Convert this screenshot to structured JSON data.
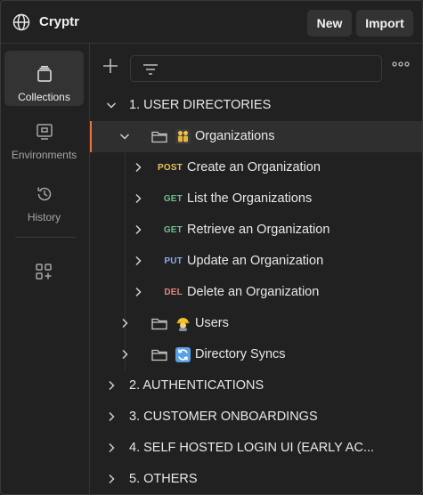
{
  "header": {
    "workspace_name": "Cryptr",
    "workspace_icon": "globe-icon",
    "new_label": "New",
    "import_label": "Import"
  },
  "sidebar": {
    "items": [
      {
        "label": "Collections",
        "icon": "collections-icon",
        "active": true
      },
      {
        "label": "Environments",
        "icon": "environments-icon",
        "active": false
      },
      {
        "label": "History",
        "icon": "history-icon",
        "active": false
      }
    ],
    "configure_icon": "configure-workbench-icon"
  },
  "toolbar": {
    "add_icon": "plus-icon",
    "filter_icon": "filter-icon",
    "more_icon": "more-options-icon"
  },
  "tree": {
    "collection": {
      "label": "1. USER DIRECTORIES",
      "expanded": true
    },
    "organizations": {
      "label": "Organizations",
      "emoji": "👬"
    },
    "requests": [
      {
        "method": "POST",
        "label": "Create an Organization"
      },
      {
        "method": "GET",
        "label": "List the Organizations"
      },
      {
        "method": "GET",
        "label": "Retrieve an Organization"
      },
      {
        "method": "PUT",
        "label": "Update an Organization"
      },
      {
        "method": "DEL",
        "label": "Delete an Organization"
      }
    ],
    "folders": [
      {
        "label": "Users",
        "emoji": "👷"
      },
      {
        "label": "Directory Syncs",
        "emoji": "🔄"
      }
    ],
    "other_collections": [
      {
        "label": "2. AUTHENTICATIONS"
      },
      {
        "label": "3. CUSTOMER ONBOARDINGS"
      },
      {
        "label": "4. SELF HOSTED LOGIN UI (EARLY AC..."
      },
      {
        "label": "5. OTHERS"
      }
    ]
  },
  "colors": {
    "accent": "#f06e3c",
    "post": "#e5c35a",
    "get": "#6bbf8e",
    "put": "#8fa8f0",
    "del": "#e0877c"
  }
}
